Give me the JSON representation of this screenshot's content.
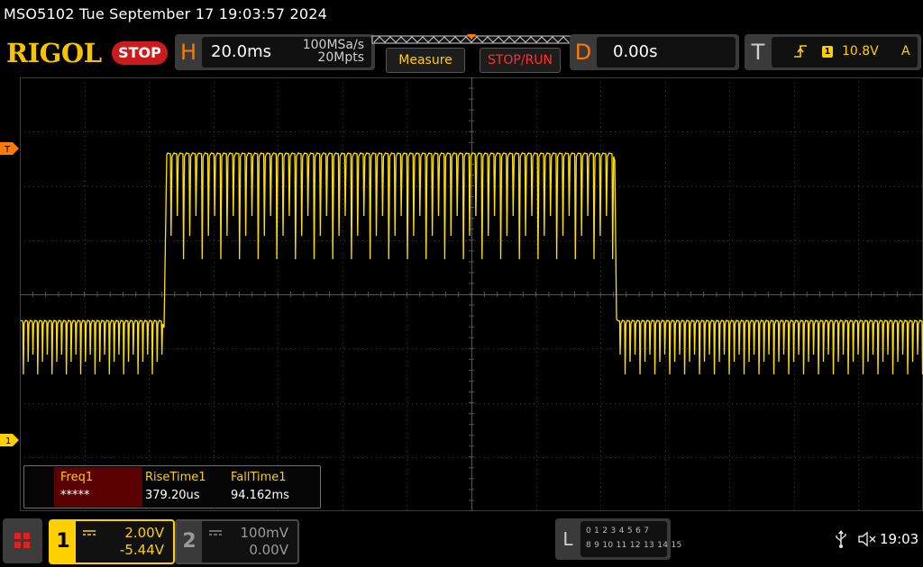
{
  "header": {
    "model_timestamp": "MSO5102  Tue September 17 19:03:57 2024",
    "logo_text": "RIGOL",
    "run_state": "STOP"
  },
  "horizontal": {
    "letter": "H",
    "timebase": "20.0ms",
    "sample_rate": "100MSa/s",
    "memory_depth": "20Mpts"
  },
  "buttons": {
    "measure": "Measure",
    "stop_run": "STOP/RUN"
  },
  "delay": {
    "letter": "D",
    "value": "0.00s"
  },
  "trigger": {
    "letter": "T",
    "channel": "1",
    "level": "10.8V",
    "mode": "A",
    "marker_label": "T"
  },
  "channel_marker": {
    "label": "1"
  },
  "measurements": [
    {
      "label": "Freq1",
      "value": "*****"
    },
    {
      "label": "RiseTime1",
      "value": "379.20us"
    },
    {
      "label": "FallTime1",
      "value": "94.162ms"
    }
  ],
  "channels": [
    {
      "number": "1",
      "scale": "2.00V",
      "offset": "-5.44V",
      "color": "#ffd000"
    },
    {
      "number": "2",
      "scale": "100mV",
      "offset": "0.00V",
      "color": "#9a9a9a"
    }
  ],
  "logic": {
    "letter": "L",
    "row1": "0 1 2 3   4 5 6 7",
    "row2": "8 9 10 11  12 13 14 15"
  },
  "status": {
    "time": "19:03"
  },
  "colors": {
    "trace": "#ffe100",
    "accent": "#ff7a00",
    "stop": "#cc1b1b"
  }
}
